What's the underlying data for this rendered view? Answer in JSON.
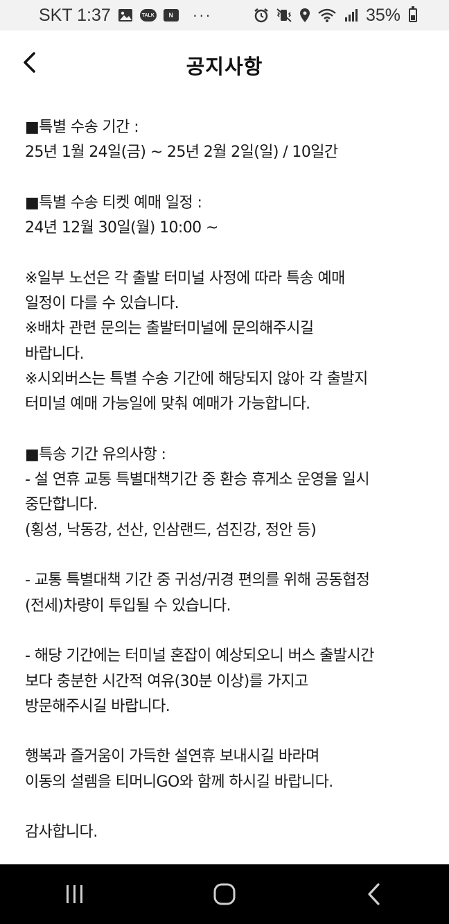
{
  "status_bar": {
    "carrier_time": "SKT 1:37",
    "talk_badge": "TALK",
    "n_badge": "N",
    "more": "···",
    "battery_percent": "35%"
  },
  "header": {
    "title": "공지사항"
  },
  "notice": {
    "lines": [
      "■특별 수송 기간 :",
      "25년 1월 24일(금) ~ 25년 2월 2일(일) / 10일간",
      "",
      "■특별 수송 티켓 예매 일정 :",
      "24년 12월 30일(월) 10:00 ~",
      "",
      "※일부 노선은 각 출발 터미널 사정에 따라 특송 예매",
      "일정이 다를 수 있습니다.",
      "※배차 관련 문의는 출발터미널에 문의해주시길",
      "바랍니다.",
      "※시외버스는 특별 수송 기간에 해당되지 않아 각 출발지",
      "터미널 예매 가능일에 맞춰 예매가 가능합니다.",
      "",
      "■특송 기간 유의사항 :",
      "- 설 연휴 교통 특별대책기간 중 환승 휴게소 운영을 일시",
      "중단합니다.",
      "(횡성, 낙동강, 선산, 인삼랜드, 섬진강, 정안 등)",
      "",
      "- 교통 특별대책 기간 중 귀성/귀경 편의를 위해 공동협정",
      "(전세)차량이 투입될 수 있습니다.",
      "",
      "- 해당 기간에는 터미널 혼잡이 예상되오니 버스 출발시간",
      "보다 충분한 시간적 여유(30분 이상)를 가지고",
      "방문해주시길 바랍니다.",
      "",
      "행복과 즐거움이 가득한 설연휴 보내시길 바라며",
      "이동의 설렘을 티머니GO와 함께 하시길 바랍니다.",
      "",
      "감사합니다."
    ]
  },
  "icons": {
    "back": "chevron-left-icon",
    "recents": "recent-apps-icon",
    "home": "home-icon",
    "nav_back": "nav-back-icon"
  },
  "colors": {
    "status_bar_bg": "#f2f2f2",
    "nav_bar_bg": "#000000",
    "text": "#1a1a1a"
  }
}
